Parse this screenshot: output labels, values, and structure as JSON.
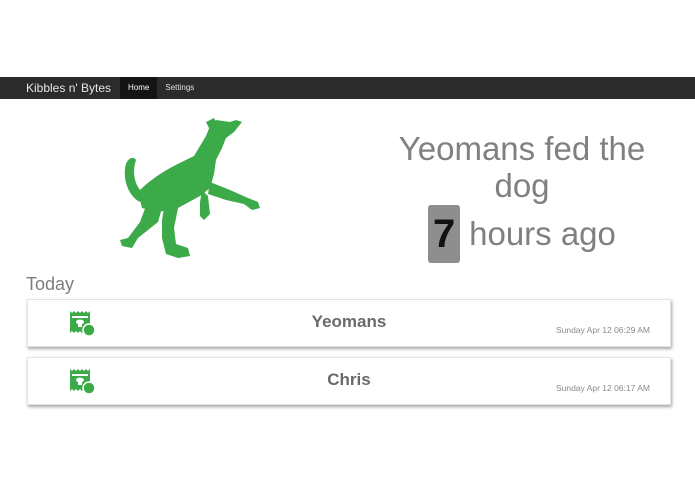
{
  "app": {
    "title": "Kibbles n' Bytes"
  },
  "nav": {
    "items": [
      {
        "label": "Home",
        "active": true
      },
      {
        "label": "Settings",
        "active": false
      }
    ]
  },
  "hero": {
    "illustration": "jumping-dog",
    "headline": "Yeomans fed the dog",
    "count": "7",
    "since_text": "hours ago"
  },
  "feed": {
    "section_title": "Today",
    "entries": [
      {
        "name": "Yeomans",
        "timestamp": "Sunday Apr 12 06:29 AM",
        "icon": "food-bag-icon"
      },
      {
        "name": "Chris",
        "timestamp": "Sunday Apr 12 06:17 AM",
        "icon": "food-bag-icon"
      }
    ]
  },
  "colors": {
    "accent": "#3daa4a",
    "navbar": "#2b2b2b",
    "text_muted": "#808080"
  }
}
